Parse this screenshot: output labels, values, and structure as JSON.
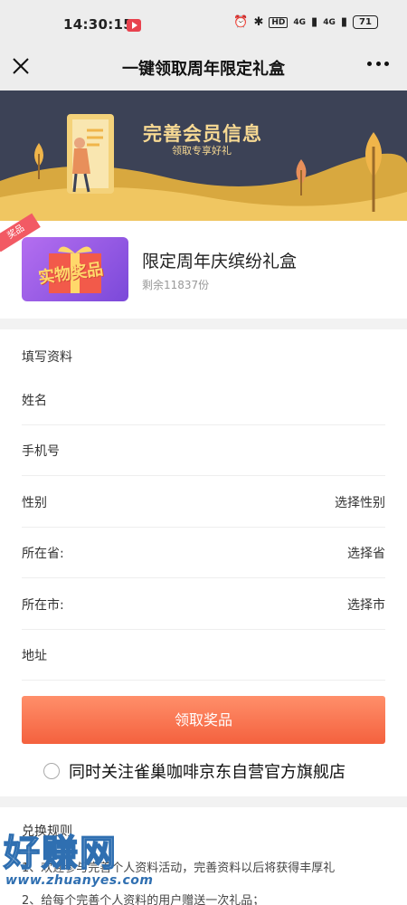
{
  "status_bar": {
    "time": "14:30:15",
    "network_labels": [
      "HD",
      "4G",
      "4G"
    ],
    "battery": "71"
  },
  "nav": {
    "title": "一键领取周年限定礼盒"
  },
  "banner": {
    "title": "完善会员信息",
    "subtitle": "领取专享好礼"
  },
  "prize": {
    "ribbon": "奖品",
    "image_label": "实物奖品",
    "name": "限定周年庆缤纷礼盒",
    "remaining": "剩余11837份"
  },
  "form": {
    "heading": "填写资料",
    "fields": [
      {
        "label": "姓名",
        "value": ""
      },
      {
        "label": "手机号",
        "value": ""
      },
      {
        "label": "性别",
        "value": "选择性别"
      },
      {
        "label": "所在省:",
        "value": "选择省"
      },
      {
        "label": "所在市:",
        "value": "选择市"
      },
      {
        "label": "地址",
        "value": ""
      }
    ],
    "submit_label": "领取奖品",
    "follow_label": "同时关注雀巢咖啡京东自营官方旗舰店"
  },
  "rules": {
    "title": "兑换规则",
    "lines": [
      "1、欢迎参与完善个人资料活动，完善资料以后将获得丰厚礼",
      "2、给每个完善个人资料的用户赠送一次礼品；"
    ]
  },
  "watermark": {
    "text": "好赚网",
    "url": "www.zhuanyes.com"
  },
  "colors": {
    "accent": "#f4613e",
    "banner_bg": "#3c4256",
    "gold": "#f7d993"
  }
}
